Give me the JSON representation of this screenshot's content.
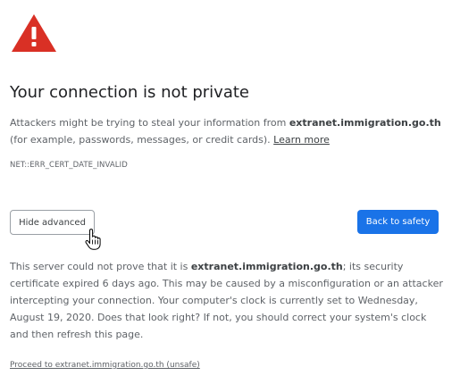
{
  "icon": {
    "name": "warning-triangle-icon",
    "color": "#d93025"
  },
  "cursor": {
    "name": "hand-pointer-cursor-icon"
  },
  "interstitial": {
    "title": "Your connection is not private",
    "intro_before": "Attackers might be trying to steal your information from ",
    "domain": "extranet.immigration.go.th",
    "intro_after": " (for example, passwords, messages, or credit cards). ",
    "learn_more": "Learn more",
    "error_code": "NET::ERR_CERT_DATE_INVALID",
    "hide_advanced_label": "Hide advanced",
    "back_to_safety_label": "Back to safety",
    "details_before": "This server could not prove that it is ",
    "details_domain": "extranet.immigration.go.th",
    "details_after": "; its security certificate expired 6 days ago. This may be caused by a misconfiguration or an attacker intercepting your connection. Your computer's clock is currently set to Wednesday, August 19, 2020. Does that look right? If not, you should correct your system's clock and then refresh this page.",
    "proceed_link": "Proceed to extranet.immigration.go.th (unsafe)"
  },
  "colors": {
    "primary_button": "#1a73e8",
    "title_text": "#202124",
    "body_text": "#5f6368"
  }
}
